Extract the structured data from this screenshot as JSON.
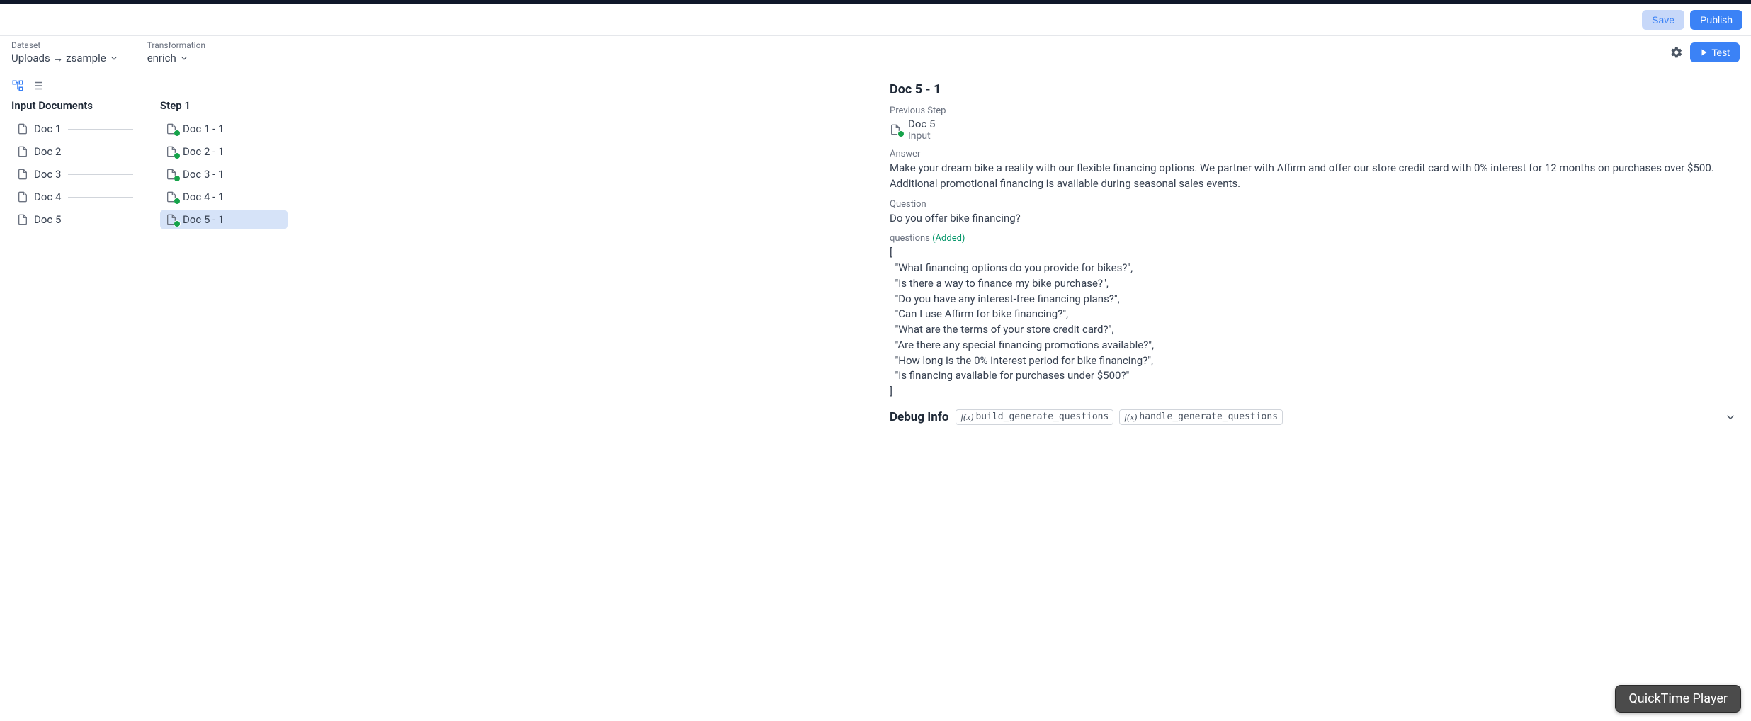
{
  "toolbar": {
    "save_label": "Save",
    "publish_label": "Publish"
  },
  "config": {
    "dataset_label": "Dataset",
    "dataset_value": "Uploads → zsample",
    "transformation_label": "Transformation",
    "transformation_value": "enrich",
    "test_label": "Test"
  },
  "columns": {
    "input_header": "Input Documents",
    "step1_header": "Step 1",
    "input_docs": [
      "Doc 1",
      "Doc 2",
      "Doc 3",
      "Doc 4",
      "Doc 5"
    ],
    "step1_docs": [
      "Doc 1 - 1",
      "Doc 2 - 1",
      "Doc 3 - 1",
      "Doc 4 - 1",
      "Doc 5 - 1"
    ],
    "selected_step1_index": 4
  },
  "detail": {
    "title": "Doc 5 - 1",
    "previous_step_label": "Previous Step",
    "previous_step_name": "Doc 5",
    "previous_step_type": "Input",
    "answer_label": "Answer",
    "answer_text": "Make your dream bike a reality with our flexible financing options. We partner with Affirm and offer our store credit card with 0% interest for 12 months on purchases over $500. Additional promotional financing is available during seasonal sales events.",
    "question_label": "Question",
    "question_text": "Do you offer bike financing?",
    "questions_label": "questions",
    "questions_added_tag": "(Added)",
    "questions_list": [
      "What financing options do you provide for bikes?",
      "Is there a way to finance my bike purchase?",
      "Do you have any interest-free financing plans?",
      "Can I use Affirm for bike financing?",
      "What are the terms of your store credit card?",
      "Are there any special financing promotions available?",
      "How long is the 0% interest period for bike financing?",
      "Is financing available for purchases under $500?"
    ],
    "debug_info_label": "Debug Info",
    "debug_functions": [
      "build_generate_questions",
      "handle_generate_questions"
    ]
  },
  "floating": {
    "quicktime_label": "QuickTime Player"
  }
}
